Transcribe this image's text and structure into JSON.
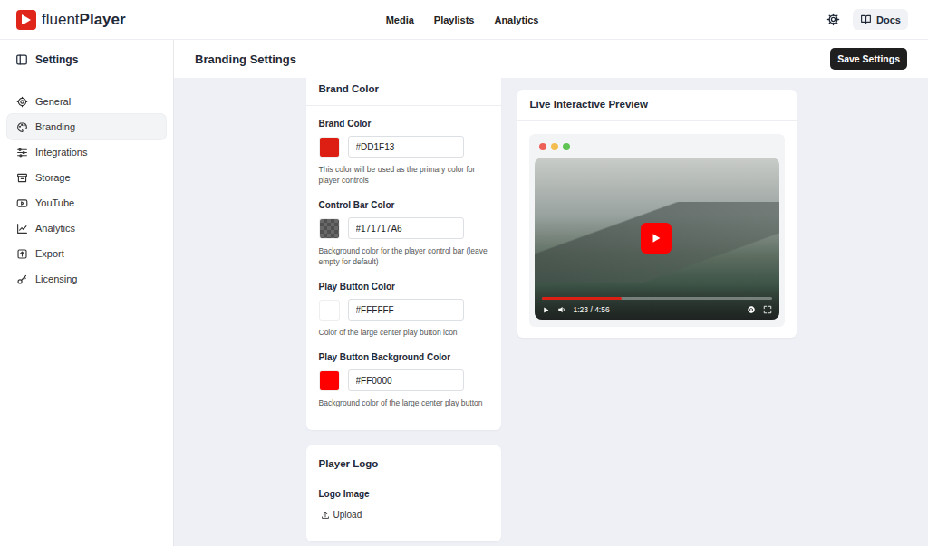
{
  "header": {
    "brand": {
      "prefix": "fluent",
      "suffix": "Player"
    },
    "nav": [
      {
        "label": "Media"
      },
      {
        "label": "Playlists"
      },
      {
        "label": "Analytics"
      }
    ],
    "docs": "Docs"
  },
  "sidebar": {
    "title": "Settings",
    "items": [
      {
        "label": "General",
        "selected": false
      },
      {
        "label": "Branding",
        "selected": true
      },
      {
        "label": "Integrations",
        "selected": false
      },
      {
        "label": "Storage",
        "selected": false
      },
      {
        "label": "YouTube",
        "selected": false
      },
      {
        "label": "Analytics",
        "selected": false
      },
      {
        "label": "Export",
        "selected": false
      },
      {
        "label": "Licensing",
        "selected": false
      }
    ]
  },
  "page": {
    "title": "Branding Settings",
    "save": "Save Settings"
  },
  "brand_card": {
    "title": "Brand Color",
    "fields": [
      {
        "label": "Brand Color",
        "value": "#DD1F13",
        "help": "This color will be used as the primary color for player controls",
        "color": "#DD1F13"
      },
      {
        "label": "Control Bar Color",
        "value": "#171717A6",
        "help": "Background color for the player control bar (leave empty for default)",
        "color": "#171717A6"
      },
      {
        "label": "Play Button Color",
        "value": "#FFFFFF",
        "help": "Color of the large center play button icon",
        "color": "#FFFFFF"
      },
      {
        "label": "Play Button Background Color",
        "value": "#FF0000",
        "help": "Background color of the large center play button",
        "color": "#FF0000"
      }
    ]
  },
  "logo_card": {
    "title": "Player Logo",
    "label": "Logo Image",
    "upload": "Upload"
  },
  "preview": {
    "title": "Live Interactive Preview",
    "progress": 0.35,
    "time": "1:23 / 4:56"
  }
}
